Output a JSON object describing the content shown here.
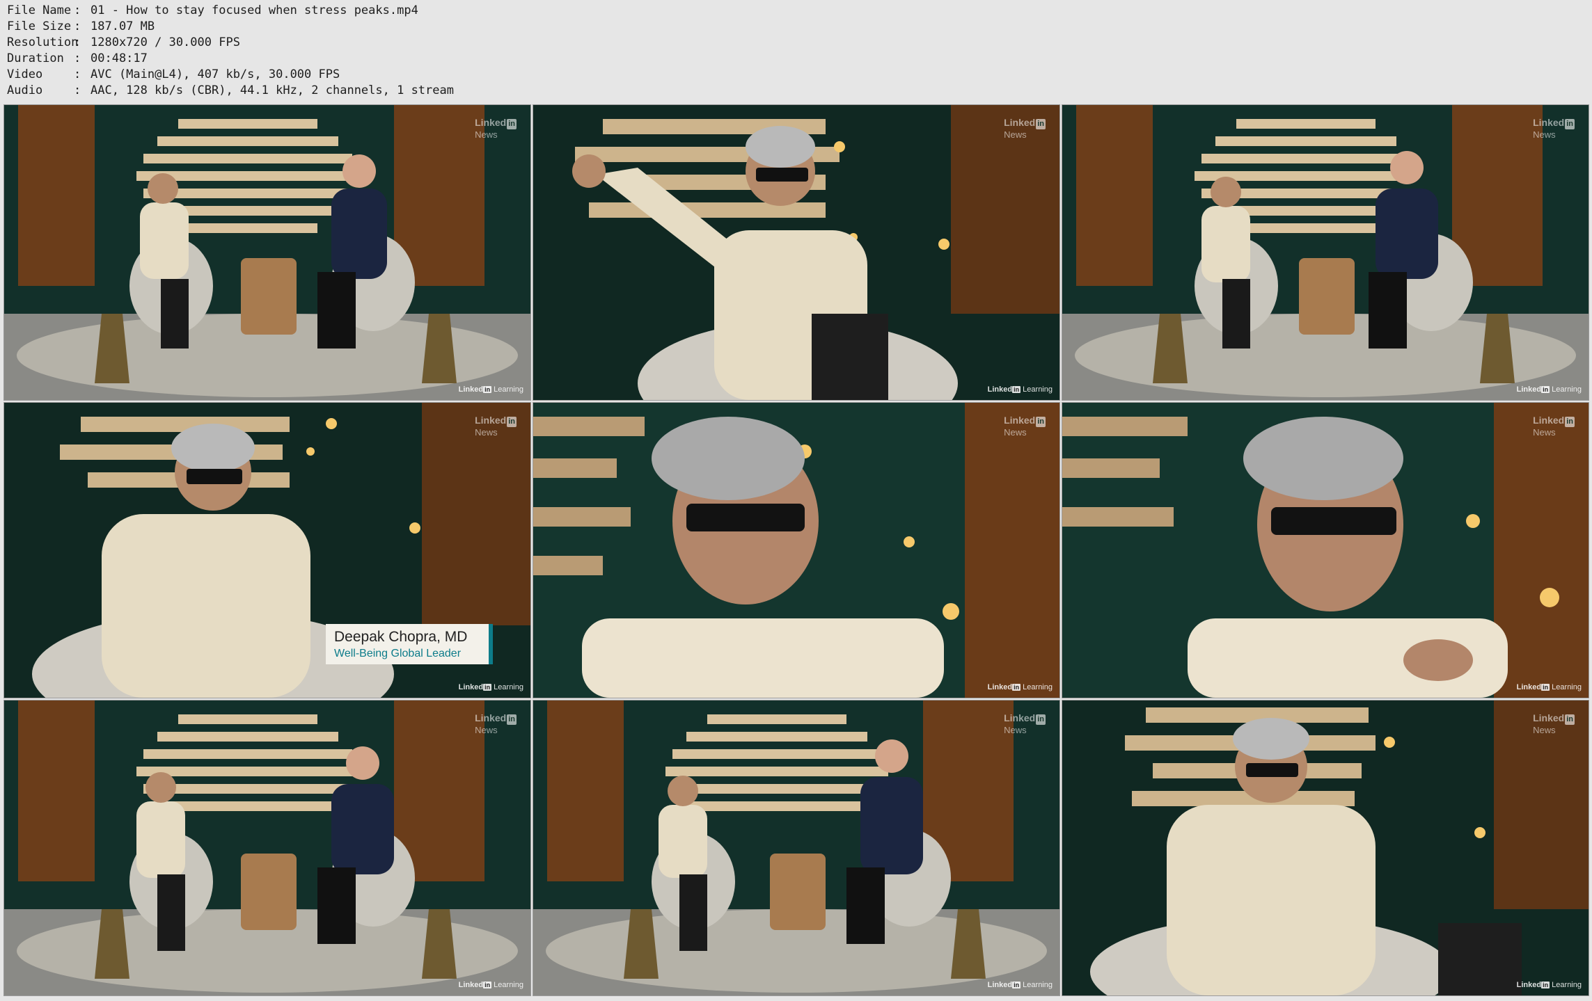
{
  "meta": [
    {
      "label": "File Name",
      "value": "01 - How to stay focused when stress peaks.mp4"
    },
    {
      "label": "File Size",
      "value": "187.07 MB"
    },
    {
      "label": "Resolution",
      "value": "1280x720 / 30.000 FPS"
    },
    {
      "label": "Duration",
      "value": "00:48:17"
    },
    {
      "label": "Video",
      "value": "AVC (Main@L4), 407 kb/s, 30.000 FPS"
    },
    {
      "label": "Audio",
      "value": "AAC, 128 kb/s (CBR), 44.1 kHz, 2 channels, 1 stream"
    }
  ],
  "separator": ":",
  "watermark": {
    "top_brand": "Linked",
    "top_in": "in",
    "top_sub": "News",
    "bottom_brand": "Linked",
    "bottom_in": "in",
    "bottom_sub": "Learning"
  },
  "lower_third": {
    "name": "Deepak Chopra, MD",
    "title": "Well-Being Global Leader"
  },
  "thumbnails": [
    {
      "shot": "wide"
    },
    {
      "shot": "medium"
    },
    {
      "shot": "wide"
    },
    {
      "shot": "medium"
    },
    {
      "shot": "close"
    },
    {
      "shot": "close"
    },
    {
      "shot": "wide"
    },
    {
      "shot": "wide"
    },
    {
      "shot": "medium"
    }
  ],
  "colors": {
    "background": "#e6e6e6",
    "set_green": "#143028",
    "accent_teal": "#0d7c8a"
  }
}
